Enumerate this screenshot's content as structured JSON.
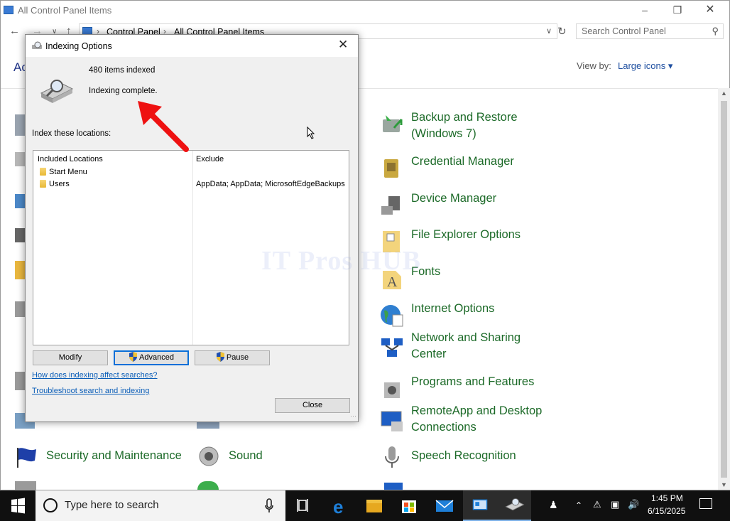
{
  "control_panel": {
    "title": "All Control Panel Items",
    "breadcrumb": [
      "Control Panel",
      "All Control Panel Items"
    ],
    "search_placeholder": "Search Control Panel",
    "heading_partial": "Ac",
    "view_by_label": "View by:",
    "view_by_value": "Large icons",
    "items": [
      {
        "label": "Backup and Restore (Windows 7)",
        "icon": "backup-restore-icon"
      },
      {
        "label": "Credential Manager",
        "icon": "credential-manager-icon"
      },
      {
        "label": "Device Manager",
        "icon": "device-manager-icon"
      },
      {
        "label": "File Explorer Options",
        "icon": "file-explorer-options-icon"
      },
      {
        "label": "Fonts",
        "icon": "fonts-icon"
      },
      {
        "label": "Internet Options",
        "icon": "internet-options-icon"
      },
      {
        "label": "Network and Sharing Center",
        "icon": "network-sharing-icon"
      },
      {
        "label": "Programs and Features",
        "icon": "programs-features-icon"
      },
      {
        "label": "RemoteApp and Desktop Connections",
        "icon": "remoteapp-icon"
      },
      {
        "label": "Security and Maintenance",
        "icon": "security-flag-icon"
      },
      {
        "label": "Sound",
        "icon": "speaker-icon"
      },
      {
        "label": "Speech Recognition",
        "icon": "microphone-icon"
      }
    ]
  },
  "dialog": {
    "title": "Indexing Options",
    "items_indexed": "480 items indexed",
    "status": "Indexing complete.",
    "locations_label": "Index these locations:",
    "columns": {
      "included": "Included Locations",
      "exclude": "Exclude"
    },
    "locations": [
      {
        "name": "Start Menu",
        "exclude": ""
      },
      {
        "name": "Users",
        "exclude": "AppData; AppData; MicrosoftEdgeBackups"
      }
    ],
    "buttons": {
      "modify": "Modify",
      "advanced": "Advanced",
      "pause": "Pause",
      "close": "Close"
    },
    "links": {
      "affect": "How does indexing affect searches?",
      "troubleshoot": "Troubleshoot search and indexing"
    }
  },
  "watermark": "IT Pros HUB",
  "taskbar": {
    "search_text": "Type here to search",
    "time": "1:45 PM",
    "date": "6/15/2025"
  }
}
